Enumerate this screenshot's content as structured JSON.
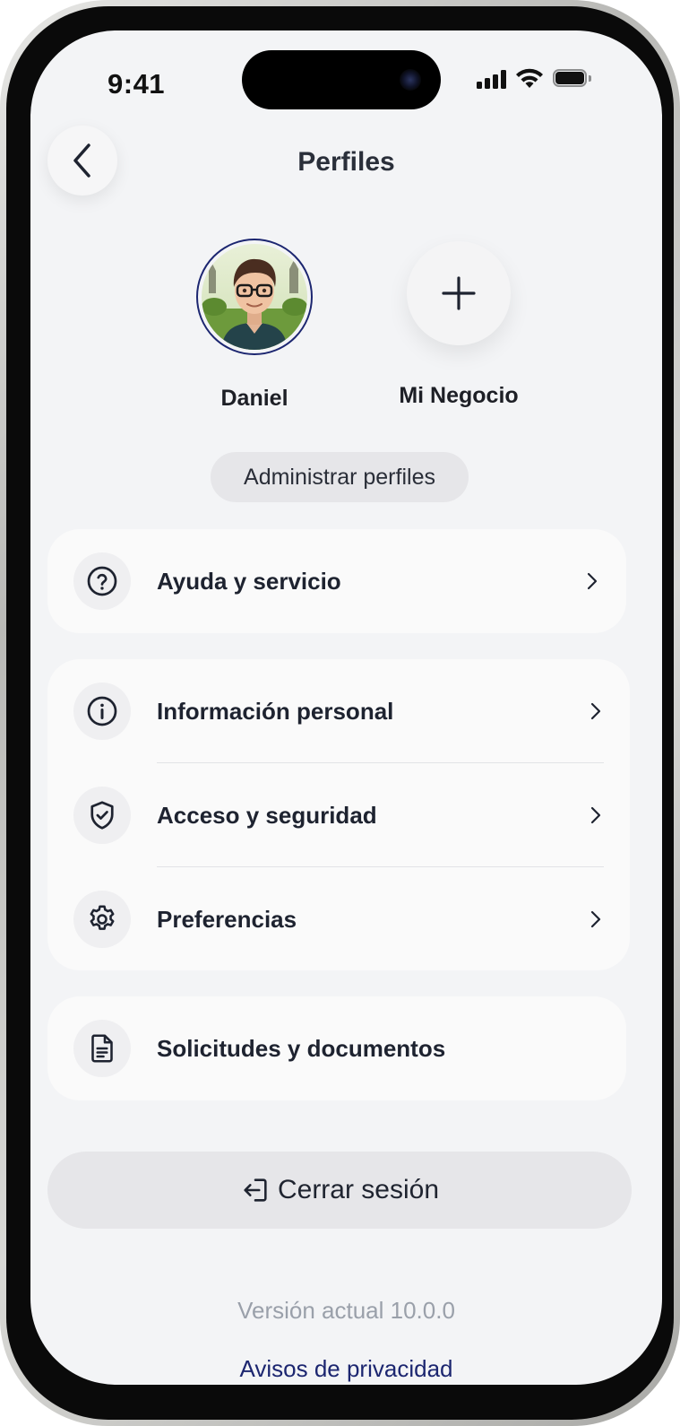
{
  "status_bar": {
    "time": "9:41"
  },
  "header": {
    "title": "Perfiles"
  },
  "profiles": [
    {
      "name": "Daniel"
    },
    {
      "name": "Mi Negocio"
    }
  ],
  "manage_profiles_label": "Administrar perfiles",
  "menu": {
    "help": {
      "label": "Ayuda y servicio",
      "icon": "help-circle-icon"
    },
    "account": [
      {
        "label": "Información personal",
        "icon": "info-icon"
      },
      {
        "label": "Acceso y seguridad",
        "icon": "shield-check-icon"
      },
      {
        "label": "Preferencias",
        "icon": "gear-icon"
      }
    ],
    "documents": {
      "label": "Solicitudes y documentos",
      "icon": "document-icon"
    }
  },
  "logout_label": "Cerrar sesión",
  "version_text": "Versión actual 10.0.0",
  "privacy_link": "Avisos de privacidad",
  "colors": {
    "accent": "#1c2670",
    "background": "#f3f4f6",
    "card": "#fafafa",
    "chip": "#e6e6e9"
  }
}
